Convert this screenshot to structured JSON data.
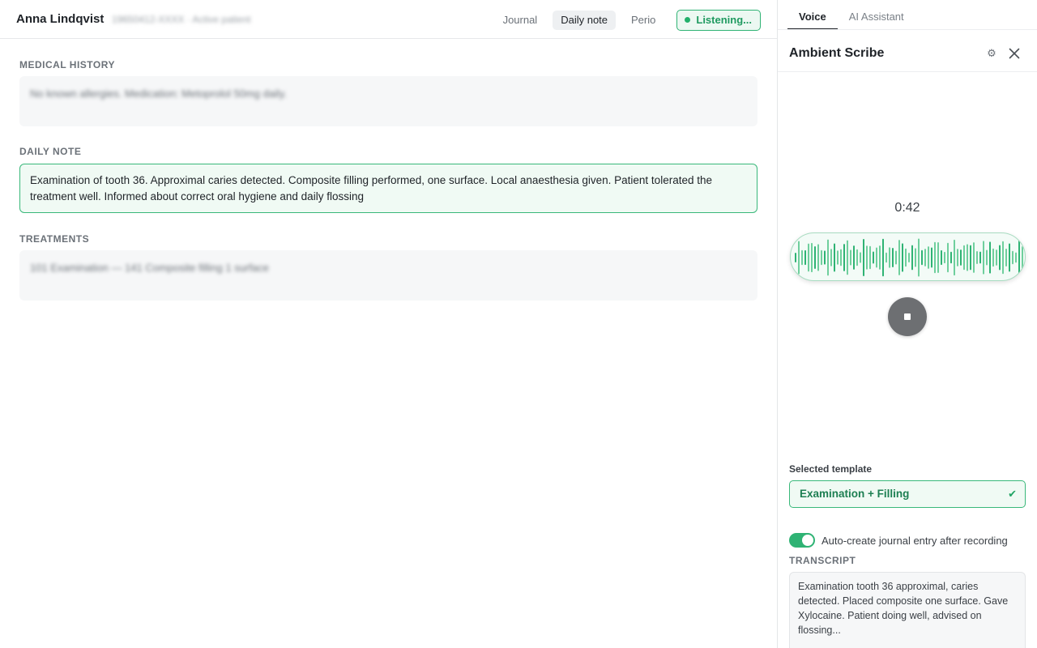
{
  "header": {
    "patient_name": "Anna Lindqvist",
    "patient_meta": "19650412-XXXX · Active patient",
    "tabs": [
      {
        "label": "Journal",
        "active": false
      },
      {
        "label": "Daily note",
        "active": true
      },
      {
        "label": "Perio",
        "active": false
      }
    ],
    "listening_label": "Listening..."
  },
  "main": {
    "medical_history": {
      "label": "MEDICAL HISTORY",
      "value": "No known allergies. Medication: Metoprolol 50mg daily."
    },
    "daily_note": {
      "label": "DAILY NOTE",
      "value": "Examination of tooth 36. Approximal caries detected. Composite filling performed, one surface. Local anaesthesia given. Patient tolerated the treatment well. Informed about correct oral hygiene and daily flossing"
    },
    "treatments": {
      "label": "TREATMENTS",
      "value": "101 Examination — 141 Composite filling 1 surface"
    }
  },
  "panel": {
    "tabs": [
      {
        "label": "Voice",
        "active": true
      },
      {
        "label": "AI Assistant",
        "active": false
      }
    ],
    "title": "Ambient Scribe",
    "settings_icon": "gear-icon",
    "close_icon": "close-icon",
    "timer": "0:42",
    "stop_icon": "stop-icon",
    "template": {
      "label": "Selected template",
      "value": "Examination + Filling",
      "check_icon": "check-icon"
    },
    "auto_create": {
      "label": "Auto-create journal entry after recording",
      "enabled": true
    },
    "transcript": {
      "label": "TRANSCRIPT",
      "text": "Examination tooth 36 approximal, caries detected. Placed composite one surface. Gave Xylocaine. Patient doing well, advised on flossing..."
    }
  },
  "colors": {
    "accent": "#2fb374",
    "accent_text": "#1d7f52",
    "accent_bg": "#f0faf4",
    "stop_button": "#6d6f72"
  }
}
